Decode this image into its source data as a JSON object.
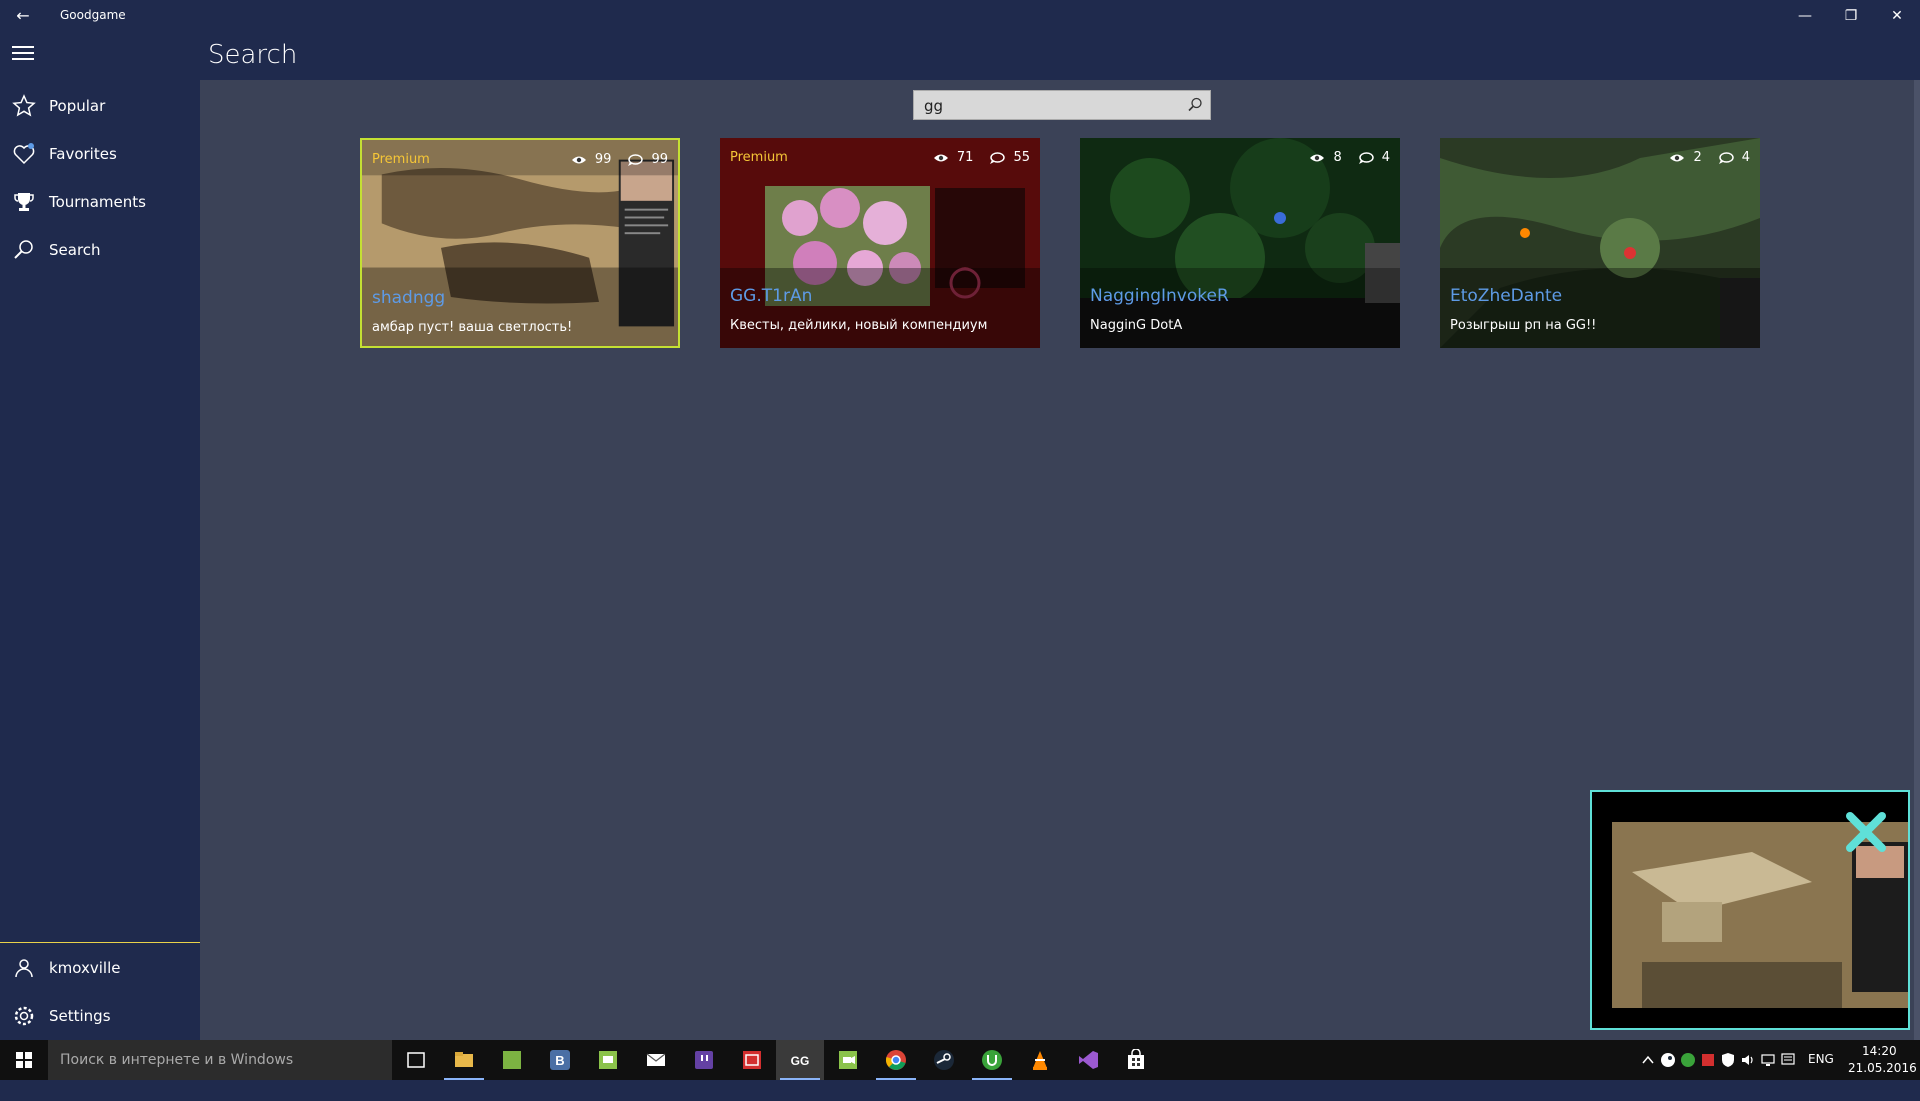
{
  "window": {
    "title": "Goodgame",
    "minimize_glyph": "—",
    "restore_glyph": "❐",
    "close_glyph": "✕",
    "back_glyph": "←"
  },
  "header": {
    "title": "Search"
  },
  "sidebar": {
    "items": [
      {
        "label": "Popular",
        "icon": "star-icon"
      },
      {
        "label": "Favorites",
        "icon": "heart-icon"
      },
      {
        "label": "Tournaments",
        "icon": "trophy-icon"
      },
      {
        "label": "Search",
        "icon": "search-icon"
      }
    ],
    "user": {
      "label": "kmoxville",
      "icon": "user-icon"
    },
    "settings": {
      "label": "Settings",
      "icon": "gear-icon"
    }
  },
  "search": {
    "value": "gg"
  },
  "cards": [
    {
      "premium": "Premium",
      "viewers": "99",
      "comments": "99",
      "channel": "shadngg",
      "description": "амбар пуст! ваша светлость!",
      "selected": true
    },
    {
      "premium": "Premium",
      "viewers": "71",
      "comments": "55",
      "channel": "GG.T1rAn",
      "description": "Квесты, дейлики, новый компендиум",
      "selected": false
    },
    {
      "premium": "",
      "viewers": "8",
      "comments": "4",
      "channel": "NaggingInvokeR",
      "description": "NagginG DotA",
      "selected": false
    },
    {
      "premium": "",
      "viewers": "2",
      "comments": "4",
      "channel": "EtoZheDante",
      "description": "Розыгрыш рп на GG!!",
      "selected": false
    }
  ],
  "taskbar": {
    "search_placeholder": "Поиск в интернете и в Windows",
    "language": "ENG",
    "time": "14:20",
    "date": "21.05.2016",
    "gg_label": "GG",
    "vk_label": "B"
  },
  "colors": {
    "accent_selected": "#c4e033",
    "premium": "#f5c637",
    "channel": "#5e9be6",
    "miniplayer_border": "#5fe0d8"
  }
}
